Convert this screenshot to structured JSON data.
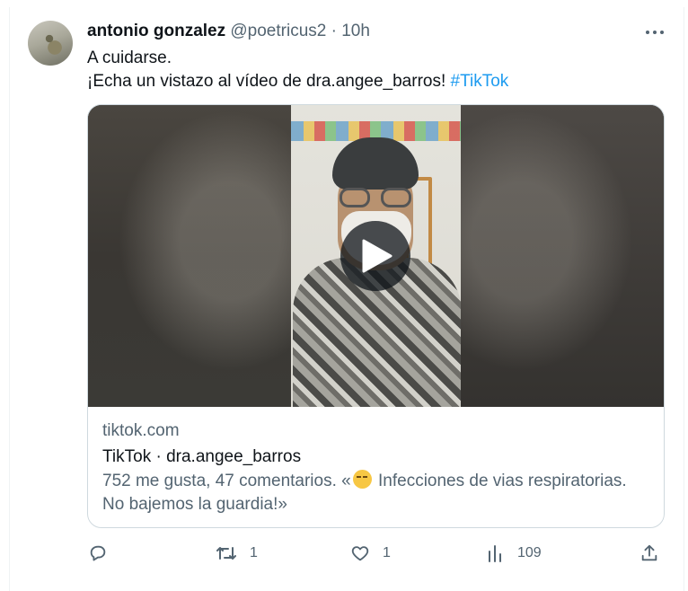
{
  "tweet": {
    "author_name": "antonio gonzalez",
    "handle": "@poetricus2",
    "separator": "·",
    "time": "10h",
    "line1": "A cuidarse.",
    "line2_prefix": "¡Echa un vistazo al vídeo de dra.angee_barros! ",
    "hashtag": "#TikTok"
  },
  "card": {
    "domain": "tiktok.com",
    "title": "TikTok · dra.angee_barros",
    "desc_before": "752 me gusta, 47 comentarios. «",
    "emoji": "sneezing-face-emoji",
    "desc_after": " Infecciones de vias respiratorias. No bajemos la guardia!»"
  },
  "actions": {
    "reply_count": "",
    "retweet_count": "1",
    "like_count": "1",
    "views_count": "109"
  },
  "colors": {
    "link": "#1d9bf0",
    "muted": "#536471",
    "text": "#0f1419",
    "border": "#cfd9de"
  }
}
